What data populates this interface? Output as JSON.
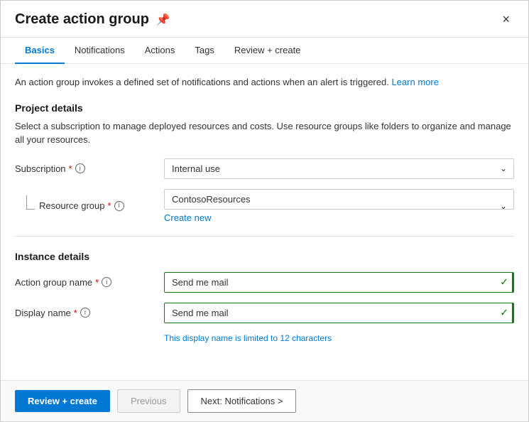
{
  "modal": {
    "title": "Create action group",
    "close_label": "×",
    "pin_icon": "📌"
  },
  "tabs": [
    {
      "id": "basics",
      "label": "Basics",
      "active": true
    },
    {
      "id": "notifications",
      "label": "Notifications",
      "active": false
    },
    {
      "id": "actions",
      "label": "Actions",
      "active": false
    },
    {
      "id": "tags",
      "label": "Tags",
      "active": false
    },
    {
      "id": "review-create",
      "label": "Review + create",
      "active": false
    }
  ],
  "info_banner": {
    "text": "An action group invokes a defined set of notifications and actions when an alert is triggered.",
    "link_text": "Learn more"
  },
  "project_details": {
    "title": "Project details",
    "description": "Select a subscription to manage deployed resources and costs. Use resource groups like folders to organize and manage all your resources."
  },
  "form": {
    "subscription": {
      "label": "Subscription",
      "required": true,
      "value": "Internal use",
      "options": [
        "Internal use"
      ]
    },
    "resource_group": {
      "label": "Resource group",
      "required": true,
      "value": "ContosoResources",
      "options": [
        "ContosoResources"
      ]
    },
    "create_new_link": "Create new"
  },
  "instance_details": {
    "title": "Instance details",
    "action_group_name": {
      "label": "Action group name",
      "required": true,
      "value": "Send me mail"
    },
    "display_name": {
      "label": "Display name",
      "required": true,
      "value": "Send me mail",
      "char_limit_note": "This display name is limited to 12 characters"
    }
  },
  "footer": {
    "review_create_label": "Review + create",
    "previous_label": "Previous",
    "next_label": "Next: Notifications >"
  }
}
